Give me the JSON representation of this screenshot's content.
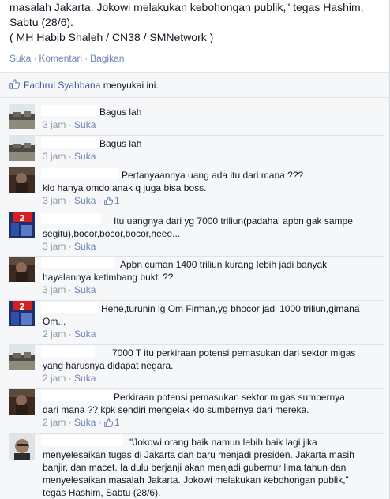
{
  "post": {
    "lines": [
      "masalah Jakarta. Jokowi melakukan kebohongan publik,\" tegas Hashim,",
      "Sabtu (28/6).",
      "( MH Habib Shaleh / CN38 / SMNetwork )"
    ],
    "actions": {
      "like": "Suka",
      "comment": "Komentari",
      "share": "Bagikan",
      "separator": "·"
    }
  },
  "likes": {
    "liker": "Fachrul Syahbana",
    "suffix": "menyukai ini."
  },
  "comments": [
    {
      "avatar": "landscape",
      "lines": [
        "Bagus lah"
      ],
      "time": "3 jam",
      "like": "Suka",
      "likes": ""
    },
    {
      "avatar": "landscape",
      "lines": [
        "Bagus lah"
      ],
      "time": "3 jam",
      "like": "Suka",
      "likes": ""
    },
    {
      "avatar": "person",
      "lines": [
        "Pertanyaannya uang ada itu dari mana ???",
        "klo hanya omdo anak q juga bisa boss."
      ],
      "time": "3 jam",
      "like": "Suka",
      "likes": "1"
    },
    {
      "avatar": "number",
      "lines": [
        "Itu uangnya dari yg 7000 triliun(padahal apbn gak sampe",
        "segitu),bocor,bocor,bocor,heee..."
      ],
      "time": "3 jam",
      "like": "Suka",
      "likes": ""
    },
    {
      "avatar": "person",
      "lines": [
        "Apbn cuman 1400 triliun kurang lebih jadi banyak",
        "hayalannya ketimbang bukti ??"
      ],
      "time": "3 jam",
      "like": "Suka",
      "likes": ""
    },
    {
      "avatar": "number",
      "lines": [
        "Hehe,turunin lg Om Firman,yg bhocor jadi 1000 triliun,gimana",
        "Om..."
      ],
      "time": "2 jam",
      "like": "Suka",
      "likes": ""
    },
    {
      "avatar": "landscape",
      "lines": [
        "7000 T itu perkiraan potensi pemasukan dari sektor migas",
        "yang harusnya didapat negara."
      ],
      "time": "2 jam",
      "like": "Suka",
      "likes": ""
    },
    {
      "avatar": "person",
      "lines": [
        "Perkiraan potensi pemasukan sektor migas sumbernya",
        "dari mana ?? kpk sendiri mengelak klo sumbernya dari mereka."
      ],
      "time": "2 jam",
      "like": "Suka",
      "likes": "1"
    },
    {
      "avatar": "face",
      "lines": [
        "\"Jokowi orang baik namun lebih baik lagi jika",
        "menyelesaikan tugas di Jakarta dan baru menjadi presiden. Jakarta masih",
        "banjir, dan macet. Ia dulu berjanji akan menjadi gubernur lima tahun dan",
        "menyelesaikan masalah Jakarta. Jokowi melakukan kebohongan publik,\"",
        "tegas Hashim, Sabtu (28/6)."
      ],
      "time": "",
      "like": "",
      "likes": ""
    }
  ],
  "colors": {
    "link": "#6d84b4",
    "name": "#3b5998",
    "meta": "#9197a3",
    "panel": "#f6f7f9"
  }
}
